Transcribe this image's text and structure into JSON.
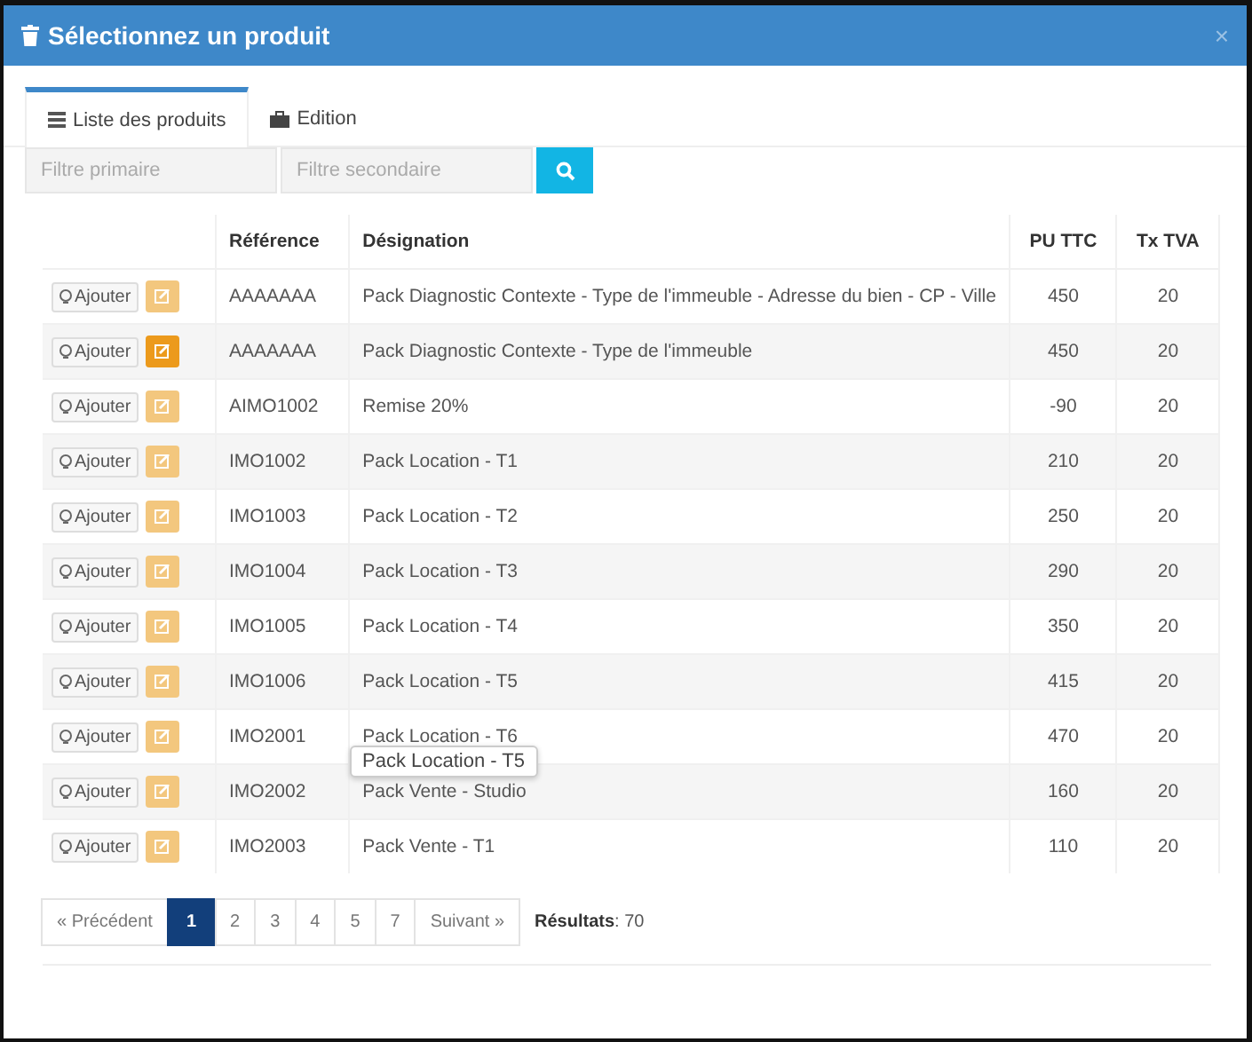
{
  "window": {
    "title": "Sélectionnez un produit",
    "close": "×"
  },
  "tabs": [
    {
      "label": "Liste des produits",
      "selected": true
    },
    {
      "label": "Edition",
      "selected": false
    }
  ],
  "filters": [
    {
      "placeholder": "Filtre primaire"
    },
    {
      "placeholder": "Filtre secondaire"
    }
  ],
  "table": {
    "columns": [
      "Référence",
      "Désignation",
      "PU TTC",
      "Tx TVA"
    ],
    "rows": [
      {
        "add": "Ajouter",
        "edit_active": false,
        "reference": "AAAAAAA",
        "designation": "Pack Diagnostic Contexte - Type de l'immeuble - Adresse du bien - CP - Ville",
        "price": "450",
        "vat": "20"
      },
      {
        "add": "Ajouter",
        "edit_active": true,
        "reference": "AAAAAAA",
        "designation": "Pack Diagnostic Contexte - Type de l'immeuble",
        "price": "450",
        "vat": "20"
      },
      {
        "add": "Ajouter",
        "edit_active": false,
        "reference": "AIMO1002",
        "designation": "Remise 20%",
        "price": "-90",
        "vat": "20"
      },
      {
        "add": "Ajouter",
        "edit_active": false,
        "reference": "IMO1002",
        "designation": "Pack Location - T1",
        "price": "210",
        "vat": "20"
      },
      {
        "add": "Ajouter",
        "edit_active": false,
        "reference": "IMO1003",
        "designation": "Pack Location - T2",
        "price": "250",
        "vat": "20"
      },
      {
        "add": "Ajouter",
        "edit_active": false,
        "reference": "IMO1004",
        "designation": "Pack Location - T3",
        "price": "290",
        "vat": "20"
      },
      {
        "add": "Ajouter",
        "edit_active": false,
        "reference": "IMO1005",
        "designation": "Pack Location - T4",
        "price": "350",
        "vat": "20"
      },
      {
        "add": "Ajouter",
        "edit_active": false,
        "reference": "IMO1006",
        "designation": "Pack Location - T5",
        "price": "415",
        "vat": "20"
      },
      {
        "add": "Ajouter",
        "edit_active": false,
        "reference": "IMO2001",
        "designation": "Pack Location - T6",
        "price": "470",
        "vat": "20"
      },
      {
        "add": "Ajouter",
        "edit_active": false,
        "reference": "IMO2002",
        "designation": "Pack Vente - Studio",
        "price": "160",
        "vat": "20"
      },
      {
        "add": "Ajouter",
        "edit_active": false,
        "reference": "IMO2003",
        "designation": "Pack Vente - T1",
        "price": "110",
        "vat": "20"
      }
    ]
  },
  "tooltip": "Pack Location - T5",
  "pagination": {
    "pages": [
      {
        "label": "« Précédent",
        "selected": false
      },
      {
        "label": "1",
        "selected": true
      },
      {
        "label": "2",
        "selected": false
      },
      {
        "label": "3",
        "selected": false
      },
      {
        "label": "4",
        "selected": false
      },
      {
        "label": "5",
        "selected": false
      },
      {
        "label": "7",
        "selected": false
      },
      {
        "label": "Suivant »",
        "selected": false
      }
    ],
    "results": "**Résultats**: 70"
  }
}
